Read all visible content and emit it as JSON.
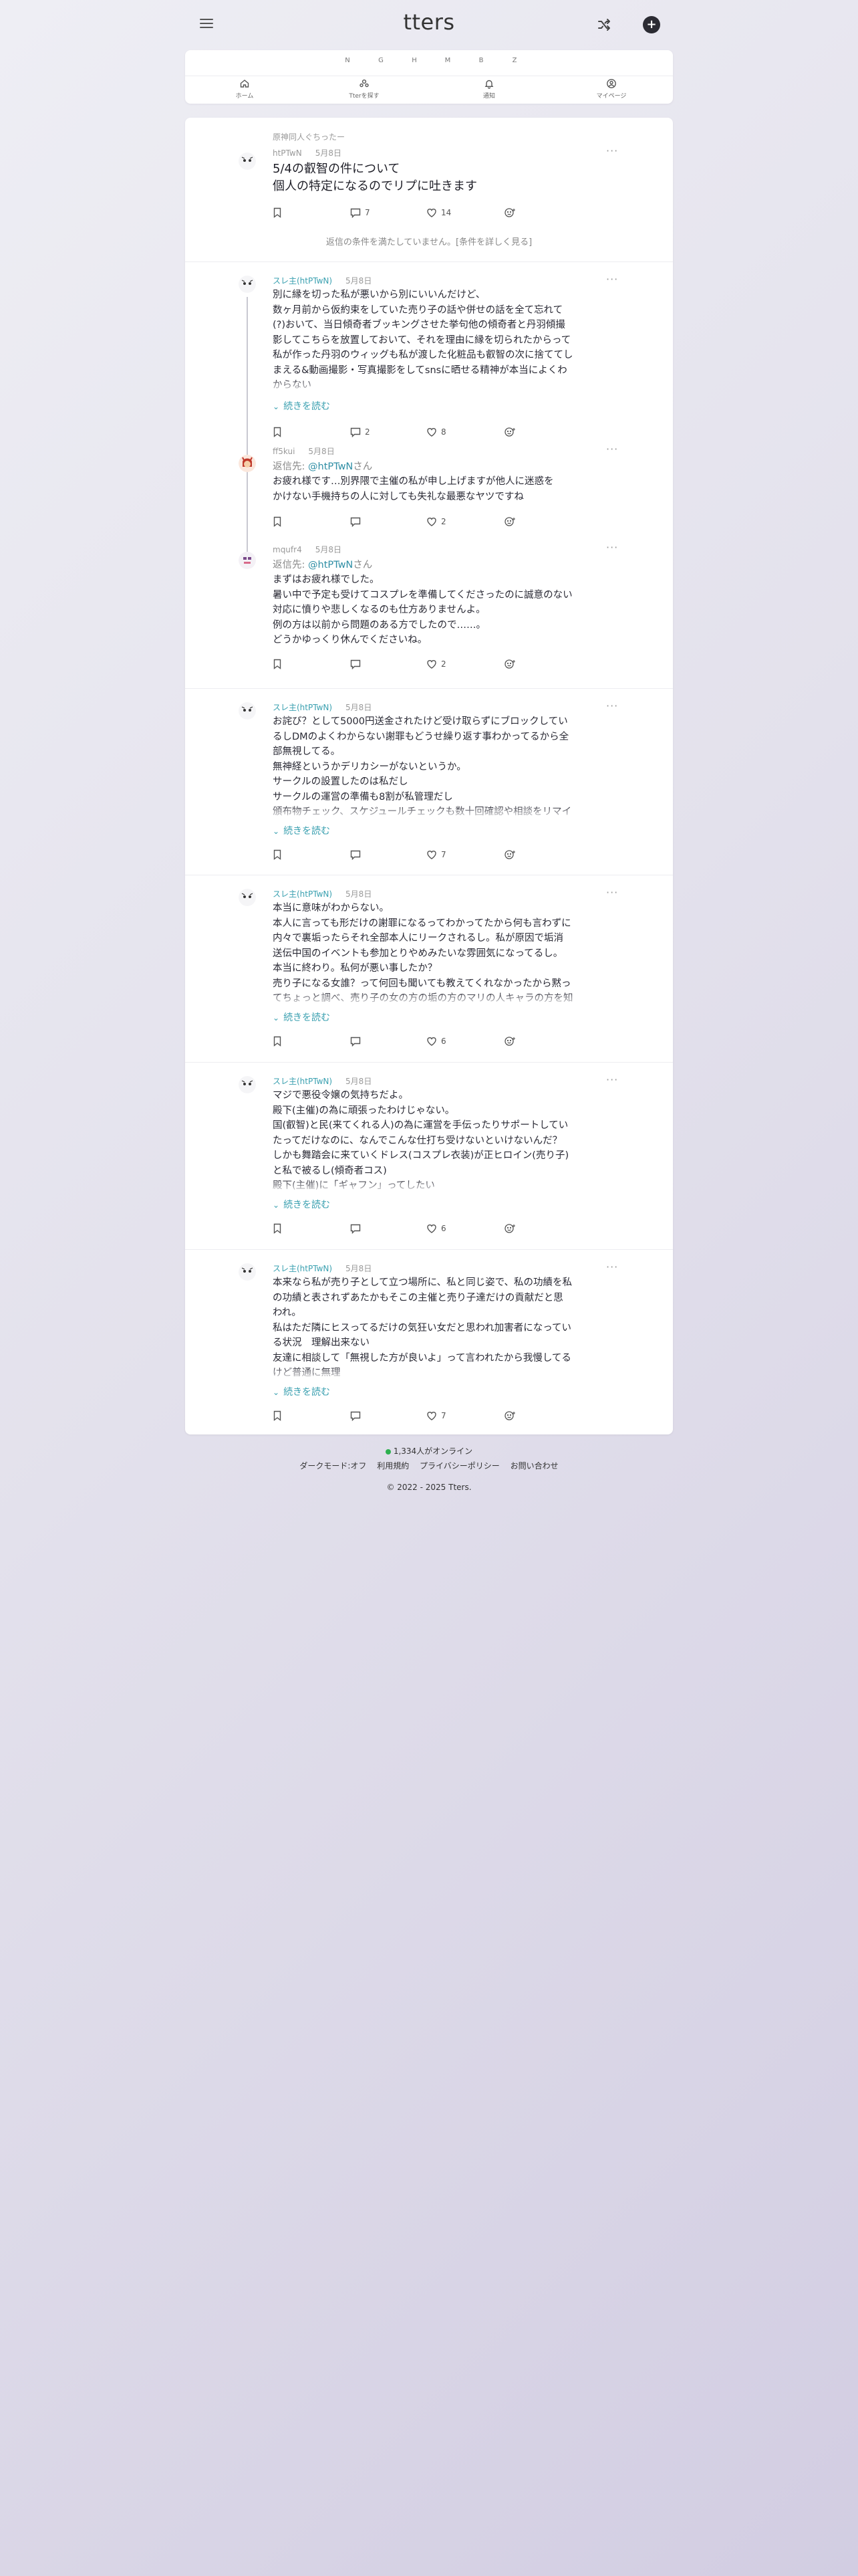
{
  "header": {
    "logo": "tters",
    "menu_icon": "hamburger-icon",
    "shuffle_icon": "shuffle-icon",
    "new_post_icon": "plus-icon"
  },
  "nav": {
    "letters": [
      "N",
      "G",
      "H",
      "M",
      "B",
      "Z"
    ],
    "items": [
      {
        "icon": "home-icon",
        "label": "ホーム"
      },
      {
        "icon": "people-icon",
        "label": "Tterを探す"
      },
      {
        "icon": "bell-icon",
        "label": "通知"
      },
      {
        "icon": "user-icon",
        "label": "マイページ"
      }
    ]
  },
  "posts": [
    {
      "category": "原神同人ぐちったー",
      "author": "htPTwN",
      "date": "5月8日",
      "title": [
        "5/4の叡智の件について",
        "個人の特定になるのでリプに吐きます"
      ],
      "bookmark": "",
      "replies": "7",
      "likes": "14",
      "notice": "返信の条件を満たしていません。[条件を詳しく見る]"
    },
    {
      "author": "スレ主(htPTwN)",
      "date": "5月8日",
      "body": [
        "別に縁を切った私が悪いから別にいいんだけど、",
        "数ヶ月前から仮約束をしていた売り子の話や併せの話を全て忘れて",
        "(?)おいて、当日傾奇者ブッキングさせた挙句他の傾奇者と丹羽傾撮",
        "影してこちらを放置しておいて、それを理由に縁を切られたからって",
        "私が作った丹羽のウィッグも私が渡した化粧品も叡智の次に捨ててし",
        "まえる&動画撮影・写真撮影をしてsnsに晒せる精神が本当によくわ",
        "からない"
      ],
      "readmore": "続きを読む",
      "replies": "2",
      "likes": "8"
    },
    {
      "author": "ff5kui",
      "date": "5月8日",
      "reply_prefix": "返信先:",
      "mention": "@htPTwN",
      "reply_suffix": "さん",
      "body": [
        "お疲れ様です…別界隈で主催の私が申し上げますが他人に迷惑を",
        "かけない手機持ちの人に対しても失礼な最悪なヤツですね"
      ],
      "replies": "",
      "likes": "2"
    },
    {
      "author": "mqufr4",
      "date": "5月8日",
      "reply_prefix": "返信先:",
      "mention": "@htPTwN",
      "reply_suffix": "さん",
      "body": [
        "まずはお疲れ様でした。",
        "暑い中で予定も受けてコスプレを準備してくださったのに誠意のない",
        "対応に憤りや悲しくなるのも仕方ありませんよ。",
        "例の方は以前から問題のある方でしたので……。",
        "どうかゆっくり休んでくださいね。"
      ],
      "replies": "",
      "likes": "2"
    },
    {
      "author": "スレ主(htPTwN)",
      "date": "5月8日",
      "body": [
        "お詫び？として5000円送金されたけど受け取らずにブロックしてい",
        "るしDMのよくわからない謝罪もどうせ繰り返す事わかってるから全",
        "部無視してる。",
        "無神経というかデリカシーがないというか。",
        "サークルの設置したのは私だし",
        "サークルの運営の準備も8割が私管理だし",
        "頒布物チェック、スケジュールチェックも数十回確認や相談をリマイ"
      ],
      "readmore": "続きを読む",
      "replies": "",
      "likes": "7"
    },
    {
      "author": "スレ主(htPTwN)",
      "date": "5月8日",
      "body": [
        "本当に意味がわからない。",
        "本人に言っても形だけの謝罪になるってわかってたから何も言わずに",
        "内々で裏垢ったらそれ全部本人にリークされるし。私が原因で垢消",
        "送伝中国のイベントも参加とりやめみたいな雰囲気になってるし。",
        "本当に終わり。私何が悪い事したか？",
        "売り子になる女誰？って何回も聞いても教えてくれなかったから黙っ",
        "てちょっと調べ、売り子の女の方の垢の方のマリの人キャラの方を知"
      ],
      "readmore": "続きを読む",
      "replies": "",
      "likes": "6"
    },
    {
      "author": "スレ主(htPTwN)",
      "date": "5月8日",
      "body": [
        "マジで悪役令嬢の気持ちだよ。",
        "殿下(主催)の為に頑張ったわけじゃない。",
        "国(叡智)と民(来てくれる人)の為に運営を手伝ったりサポートしてい",
        "たってだけなのに、なんでこんな仕打ち受けないといけないんだ？",
        "しかも舞踏会に来ていくドレス(コスプレ衣装)が正ヒロイン(売り子)",
        "と私で被るし(傾奇者コス)",
        "殿下(主催)に「ギャフン」ってしたい"
      ],
      "readmore": "続きを読む",
      "replies": "",
      "likes": "6"
    },
    {
      "author": "スレ主(htPTwN)",
      "date": "5月8日",
      "body": [
        "本来なら私が売り子として立つ場所に、私と同じ姿で、私の功績を私",
        "の功績と表されずあたかもそこの主催と売り子達だけの貢献だと思",
        "われ。",
        "私はただ隣にヒスってるだけの気狂い女だと思われ加害者になってい",
        "る状況　理解出来ない",
        "友達に相談して「無視した方が良いよ」って言われたから我慢してる",
        "けど普通に無理"
      ],
      "readmore": "続きを読む",
      "replies": "",
      "likes": "7"
    }
  ],
  "footer": {
    "online": "1,334人がオンライン",
    "links": [
      "ダークモード:オフ",
      "利用規約",
      "プライバシーポリシー",
      "お問い合わせ"
    ],
    "copyright": "© 2022 - 2025 Tters."
  }
}
